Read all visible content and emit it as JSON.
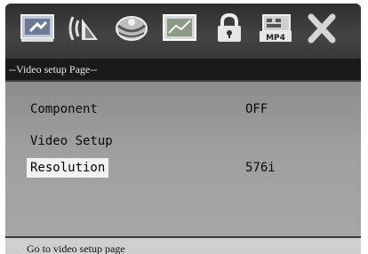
{
  "icons": [
    {
      "name": "general-setup-icon",
      "selected": false
    },
    {
      "name": "audio-setup-icon",
      "selected": false
    },
    {
      "name": "dolby-setup-icon",
      "selected": false
    },
    {
      "name": "video-setup-icon",
      "selected": true
    },
    {
      "name": "lock-icon",
      "selected": false
    },
    {
      "name": "mp4-setup-icon",
      "selected": false,
      "text": "MP4"
    },
    {
      "name": "exit-icon",
      "selected": false
    }
  ],
  "page_title": "--Video setup Page--",
  "menu": {
    "items": [
      {
        "label": "Component",
        "value": "OFF"
      },
      {
        "label": "Video Setup",
        "value": ""
      },
      {
        "label": "Resolution",
        "value": "576i",
        "selected": true
      }
    ]
  },
  "footer_hint": "Go to video setup page"
}
